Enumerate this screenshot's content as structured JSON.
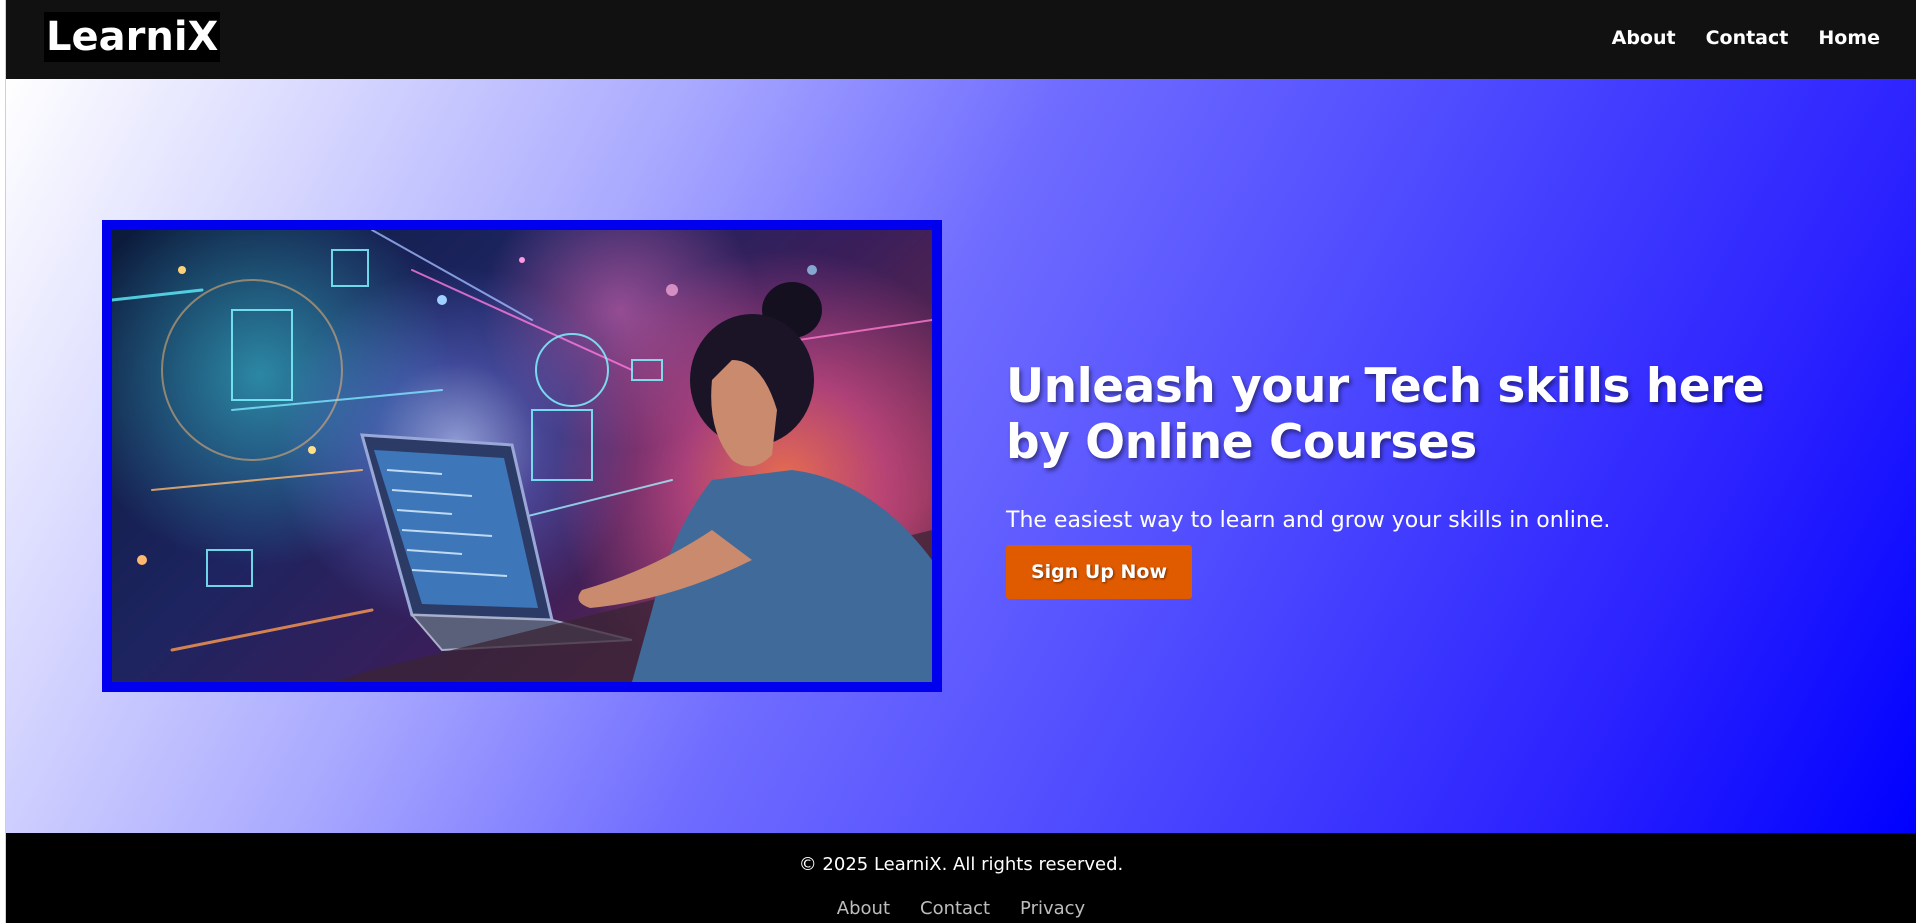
{
  "header": {
    "logo": "LearniX",
    "nav": [
      {
        "label": "About"
      },
      {
        "label": "Contact"
      },
      {
        "label": "Home"
      }
    ]
  },
  "hero": {
    "title": "Unleash your Tech skills here by Online Courses",
    "subtitle": "The easiest way to learn and grow your skills in online.",
    "cta_label": "Sign Up Now",
    "image_alt": "person-coding-on-laptop-illustration"
  },
  "footer": {
    "copyright": "© 2025 LearniX. All rights reserved.",
    "links": [
      {
        "label": "About"
      },
      {
        "label": "Contact"
      },
      {
        "label": "Privacy"
      }
    ]
  },
  "colors": {
    "header_bg": "#111111",
    "hero_gradient_start": "#ffffff",
    "hero_gradient_end": "#0000ff",
    "image_border": "#0000ee",
    "cta_bg": "#e05a00",
    "footer_bg": "#000000"
  }
}
